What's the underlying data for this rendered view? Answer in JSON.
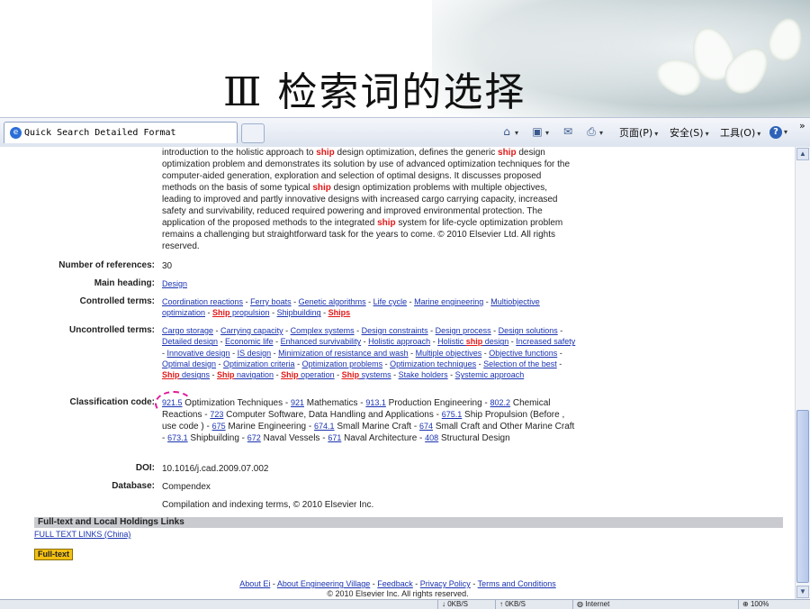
{
  "slide": {
    "title": "Ⅲ  检索词的选择"
  },
  "browser": {
    "tab_title": "Quick Search Detailed Format",
    "commands": [
      {
        "icon": "home-icon",
        "glyph": "⌂",
        "label": ""
      },
      {
        "icon": "feeds-icon",
        "glyph": "▣",
        "label": ""
      },
      {
        "icon": "mail-icon",
        "glyph": "✉",
        "label": ""
      },
      {
        "icon": "print-icon",
        "glyph": "⎙",
        "label": ""
      },
      {
        "icon": "page-menu",
        "glyph": "",
        "label": "页面(P)"
      },
      {
        "icon": "safety-menu",
        "glyph": "",
        "label": "安全(S)"
      },
      {
        "icon": "tools-menu",
        "glyph": "",
        "label": "工具(O)"
      },
      {
        "icon": "help-icon",
        "glyph": "?",
        "label": ""
      }
    ],
    "chevron": "»"
  },
  "record": {
    "abstract_parts": [
      {
        "t": "introduction to the holistic approach to "
      },
      {
        "t": "ship",
        "hl": true
      },
      {
        "t": " design optimization, defines the generic "
      },
      {
        "t": "ship",
        "hl": true
      },
      {
        "t": " design optimization problem and demonstrates its solution by use of advanced optimization techniques for the computer-aided generation, exploration and selection of optimal designs. It discusses proposed methods on the basis of some typical "
      },
      {
        "t": "ship",
        "hl": true
      },
      {
        "t": " design optimization problems with multiple objectives, leading to improved and partly innovative designs with increased cargo carrying capacity, increased safety and survivability, reduced required powering and improved environmental protection. The application of the proposed methods to the integrated "
      },
      {
        "t": "ship",
        "hl": true
      },
      {
        "t": " system for life-cycle optimization problem remains a challenging but straightforward task for the years to come. © 2010 Elsevier Ltd. All rights reserved."
      }
    ],
    "num_refs_label": "Number of references:",
    "num_refs": "30",
    "main_heading_label": "Main heading:",
    "main_heading": "Design",
    "controlled_label": "Controlled terms:",
    "controlled_terms": [
      [
        {
          "t": "Coordination reactions"
        }
      ],
      [
        {
          "t": "Ferry boats"
        }
      ],
      [
        {
          "t": "Genetic algorithms"
        }
      ],
      [
        {
          "t": "Life cycle"
        }
      ],
      [
        {
          "t": "Marine engineering"
        }
      ],
      [
        {
          "t": "Multiobjective optimization"
        }
      ],
      [
        {
          "t": "Ship",
          "hl": true
        },
        {
          "t": " propulsion"
        }
      ],
      [
        {
          "t": "Shipbuilding"
        }
      ],
      [
        {
          "t": "Ships",
          "hl": true
        }
      ]
    ],
    "uncontrolled_label": "Uncontrolled terms:",
    "uncontrolled_terms": [
      [
        {
          "t": "Cargo storage"
        }
      ],
      [
        {
          "t": "Carrying capacity"
        }
      ],
      [
        {
          "t": "Complex systems"
        }
      ],
      [
        {
          "t": "Design constraints"
        }
      ],
      [
        {
          "t": "Design process"
        }
      ],
      [
        {
          "t": "Design solutions"
        }
      ],
      [
        {
          "t": "Detailed design"
        }
      ],
      [
        {
          "t": "Economic life"
        }
      ],
      [
        {
          "t": "Enhanced survivability"
        }
      ],
      [
        {
          "t": "Holistic approach"
        }
      ],
      [
        {
          "t": "Holistic "
        },
        {
          "t": "ship",
          "hl": true
        },
        {
          "t": " design"
        }
      ],
      [
        {
          "t": "Increased safety"
        }
      ],
      [
        {
          "t": "Innovative design"
        }
      ],
      [
        {
          "t": "IS design"
        }
      ],
      [
        {
          "t": "Minimization of resistance and wash"
        }
      ],
      [
        {
          "t": "Multiple objectives"
        }
      ],
      [
        {
          "t": "Objective functions"
        }
      ],
      [
        {
          "t": "Optimal design"
        }
      ],
      [
        {
          "t": "Optimization criteria"
        }
      ],
      [
        {
          "t": "Optimization problems"
        }
      ],
      [
        {
          "t": "Optimization techniques"
        }
      ],
      [
        {
          "t": "Selection of the best"
        }
      ],
      [
        {
          "t": "Ship",
          "hl": true
        },
        {
          "t": " designs"
        }
      ],
      [
        {
          "t": "Ship",
          "hl": true
        },
        {
          "t": " navigation"
        }
      ],
      [
        {
          "t": "Ship",
          "hl": true
        },
        {
          "t": " operation"
        }
      ],
      [
        {
          "t": "Ship",
          "hl": true
        },
        {
          "t": " systems"
        }
      ],
      [
        {
          "t": "Stake holders"
        }
      ],
      [
        {
          "t": "Systemic approach"
        }
      ]
    ],
    "class_label": "Classification code:",
    "class_codes": [
      {
        "code": "921.5",
        "name": "Optimization Techniques"
      },
      {
        "code": "921",
        "name": "Mathematics"
      },
      {
        "code": "913.1",
        "name": "Production Engineering"
      },
      {
        "code": "802.2",
        "name": "Chemical Reactions"
      },
      {
        "code": "723",
        "name": "Computer Software, Data Handling and Applications"
      },
      {
        "code": "675.1",
        "name": "Ship Propulsion (Before , use code )"
      },
      {
        "code": "675",
        "name": "Marine Engineering"
      },
      {
        "code": "674.1",
        "name": "Small Marine Craft"
      },
      {
        "code": "674",
        "name": "Small Craft and Other Marine Craft"
      },
      {
        "code": "673.1",
        "name": "Shipbuilding"
      },
      {
        "code": "672",
        "name": "Naval Vessels"
      },
      {
        "code": "671",
        "name": "Naval Architecture"
      },
      {
        "code": "408",
        "name": "Structural Design"
      }
    ],
    "doi_label": "DOI:",
    "doi": "10.1016/j.cad.2009.07.002",
    "database_label": "Database:",
    "database": "Compendex",
    "compilation": "Compilation and indexing terms, © 2010 Elsevier Inc."
  },
  "holdings": {
    "title": "Full-text and Local Holdings Links",
    "link": "FULL TEXT LINKS (China)",
    "button": "Full-text"
  },
  "footer": {
    "links": [
      "About Ei",
      "About Engineering Village",
      "Feedback",
      "Privacy Policy",
      "Terms and Conditions"
    ],
    "copyright": "© 2010 Elsevier Inc. All rights reserved."
  },
  "status": {
    "down": "0KB/S",
    "up": "0KB/S",
    "zone": "Internet",
    "zoom": "100%"
  },
  "colors": {
    "highlight": "#e01818",
    "link": "#1a33b0",
    "annotation": "#e0189a",
    "fulltext_button": "#f2c012"
  }
}
